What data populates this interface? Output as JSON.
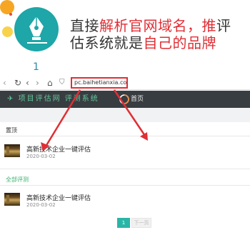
{
  "headline": {
    "line1_a": "直接",
    "line1_b": "解析官网域名，",
    "line1_c": "推",
    "line1_d": "评",
    "line2_a": "估系统就是",
    "line2_b": "自己的品牌"
  },
  "step_number": "1",
  "browser": {
    "url": "pc.baihetianxia.com"
  },
  "nav": {
    "logo_text": "项目评估网 评测系统",
    "home_label": "首页"
  },
  "sections": [
    {
      "label": "置顶",
      "items": [
        {
          "title": "高新技术企业一键评估",
          "date": "2020-03-02"
        }
      ]
    },
    {
      "label": "全部评测",
      "items": [
        {
          "title": "高新技术企业一键评估",
          "date": "2020-03-02"
        }
      ]
    }
  ],
  "pagination": {
    "current": "1",
    "next_label": "下一页"
  },
  "colors": {
    "accent_red": "#e02e35",
    "teal": "#1ea6a8",
    "nav_bg": "#383d41",
    "green": "#3cb371"
  }
}
